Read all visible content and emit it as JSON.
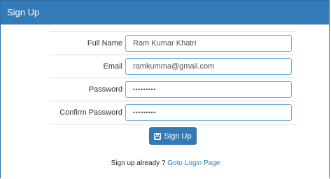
{
  "panel": {
    "title": "Sign Up"
  },
  "form": {
    "full_name": {
      "label": "Full Name",
      "value": "Ram Kumar Khatri"
    },
    "email": {
      "label": "Email",
      "value": "ramkumma@gmail.com"
    },
    "password": {
      "label": "Password",
      "value": "•••••••••"
    },
    "confirm_password": {
      "label": "Confirm Password",
      "value": "•••••••••"
    },
    "submit_label": "Sign Up",
    "submit_icon": "save-icon"
  },
  "footer": {
    "prompt": "Sign up already ? ",
    "link_label": "Goto Login Page"
  },
  "colors": {
    "primary": "#337ab7",
    "input_focus_border": "#66afe9"
  }
}
